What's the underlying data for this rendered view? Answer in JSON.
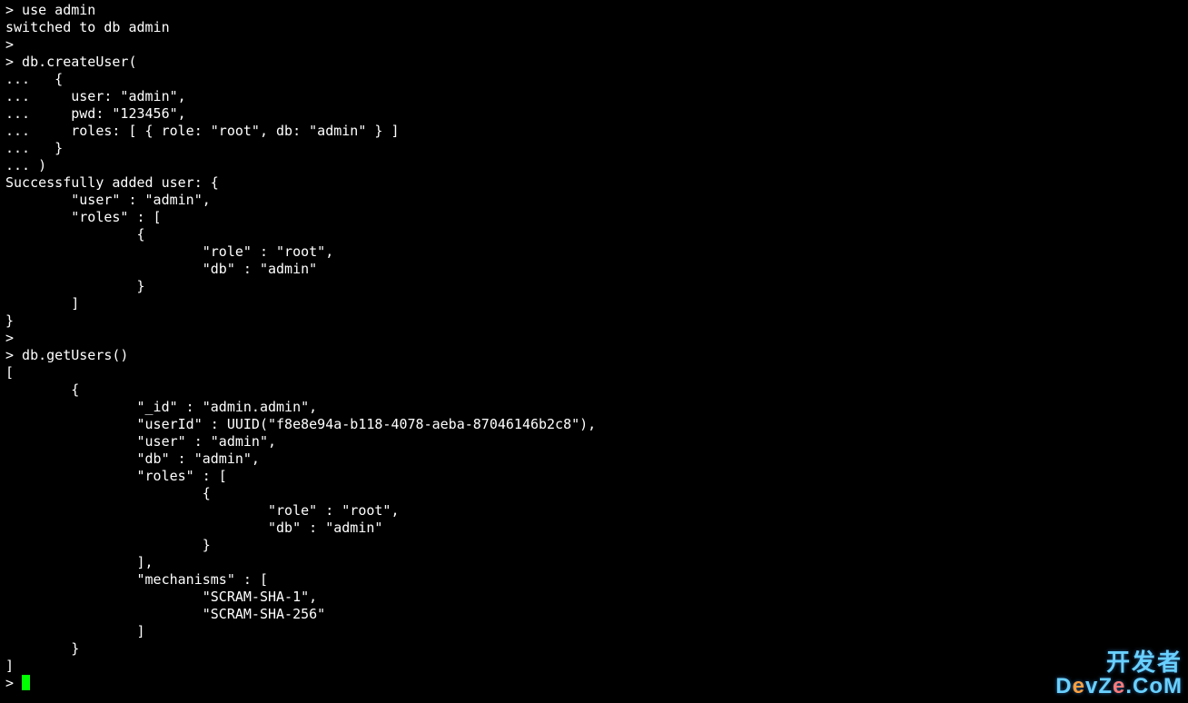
{
  "terminal": {
    "lines": [
      "> use admin",
      "switched to db admin",
      ">",
      "> db.createUser(",
      "...   {",
      "...     user: \"admin\",",
      "...     pwd: \"123456\",",
      "...     roles: [ { role: \"root\", db: \"admin\" } ]",
      "...   }",
      "... )",
      "Successfully added user: {",
      "        \"user\" : \"admin\",",
      "        \"roles\" : [",
      "                {",
      "                        \"role\" : \"root\",",
      "                        \"db\" : \"admin\"",
      "                }",
      "        ]",
      "}",
      ">",
      "> db.getUsers()",
      "[",
      "        {",
      "                \"_id\" : \"admin.admin\",",
      "                \"userId\" : UUID(\"f8e8e94a-b118-4078-aeba-87046146b2c8\"),",
      "                \"user\" : \"admin\",",
      "                \"db\" : \"admin\",",
      "                \"roles\" : [",
      "                        {",
      "                                \"role\" : \"root\",",
      "                                \"db\" : \"admin\"",
      "                        }",
      "                ],",
      "                \"mechanisms\" : [",
      "                        \"SCRAM-SHA-1\",",
      "                        \"SCRAM-SHA-256\"",
      "                ]",
      "        }",
      "]"
    ],
    "prompt": "> "
  },
  "watermark": {
    "line1": "开发者",
    "line2_pre": "D",
    "line2_o1": "e",
    "line2_mid": "vZ",
    "line2_o2": "e",
    "line2_post": ".CoM"
  }
}
